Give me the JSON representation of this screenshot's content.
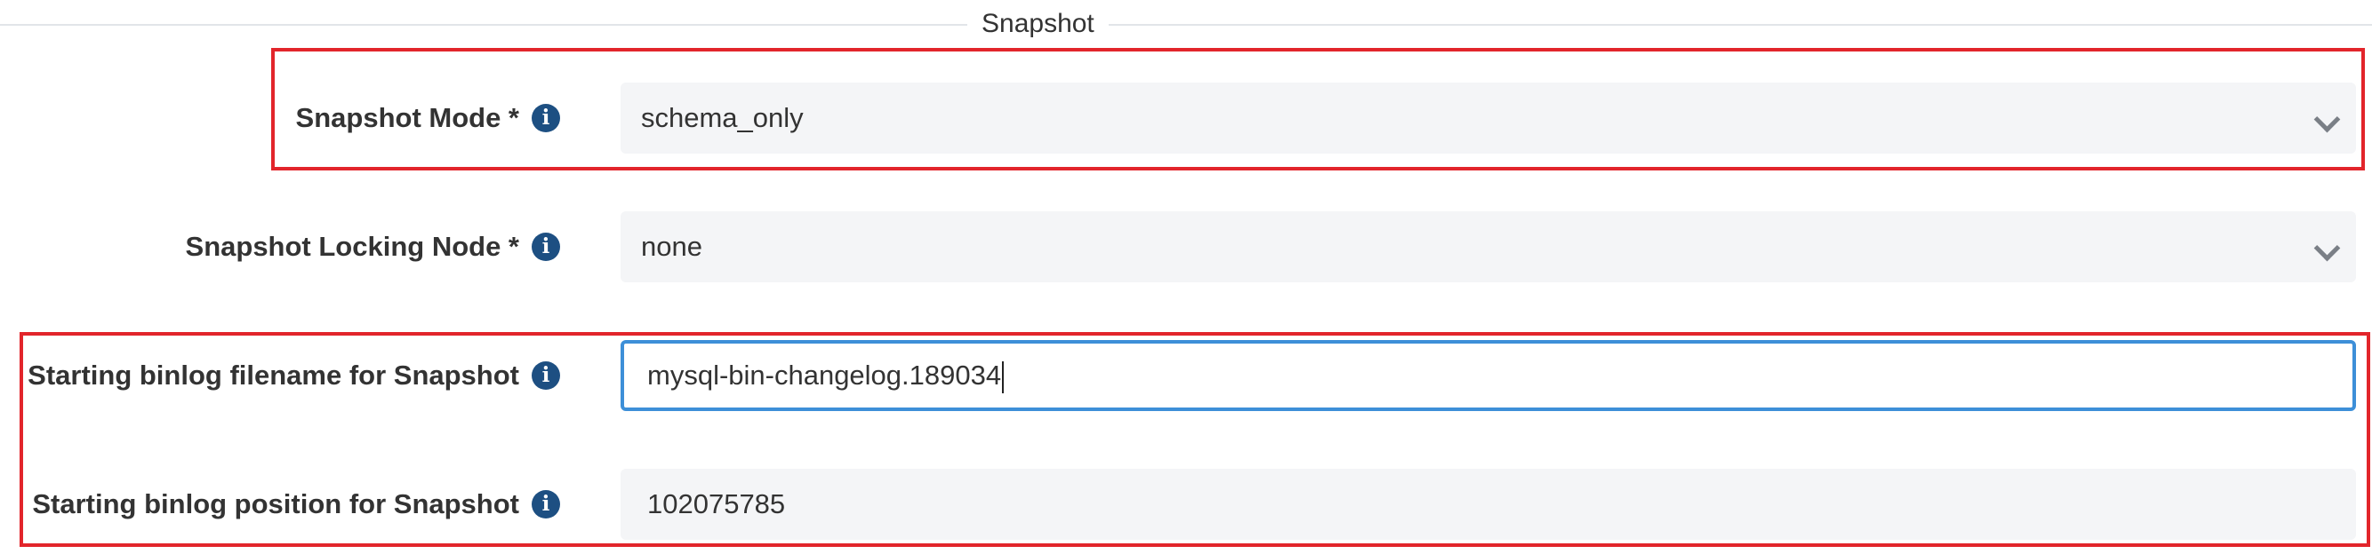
{
  "section": {
    "title": "Snapshot"
  },
  "fields": {
    "snapshot_mode": {
      "label": "Snapshot Mode *",
      "value": "schema_only",
      "icon": "info-icon"
    },
    "snapshot_locking_node": {
      "label": "Snapshot Locking Node *",
      "value": "none",
      "icon": "info-icon"
    },
    "binlog_filename": {
      "label": "Starting binlog filename for Snapshot",
      "value": "mysql-bin-changelog.189034",
      "icon": "info-icon"
    },
    "binlog_position": {
      "label": "Starting binlog position for Snapshot",
      "value": "102075785",
      "icon": "info-icon"
    }
  },
  "colors": {
    "highlight": "#e2252b",
    "focus": "#3d8fd8",
    "icon": "#1d4f82",
    "field_bg": "#f4f5f7"
  }
}
